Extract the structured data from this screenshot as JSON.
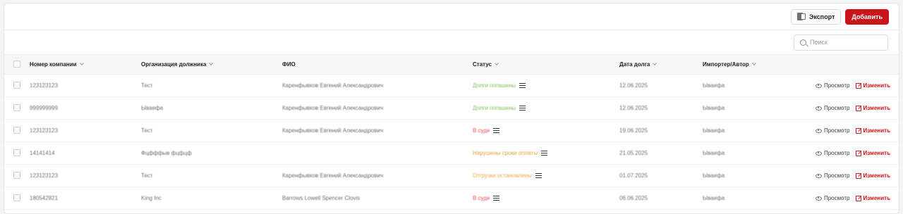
{
  "toolbar": {
    "export_label": "Экспорт",
    "add_label": "Добавить",
    "export_icon": "excel-icon"
  },
  "search": {
    "placeholder": "Поиск"
  },
  "columns": {
    "company_number": "Номер компании",
    "debtor_org": "Организация должника",
    "full_name": "ФИО",
    "status": "Статус",
    "debt_date": "Дата долга",
    "importer": "Импортер/Автор"
  },
  "rows": [
    {
      "company_number": "123123123",
      "debtor_org": "Тест",
      "full_name": "Каренфывков Евгений Александрович",
      "status": "Долги погашены",
      "status_color": "#79c25a",
      "debt_date": "12.06.2025",
      "importer": "Ываефа",
      "view": "Просмотр",
      "edit": "Изменить"
    },
    {
      "company_number": "999999999",
      "debtor_org": "Ываефа",
      "full_name": "Каренфывков Евгений Александрович",
      "status": "Долги погашены",
      "status_color": "#79c25a",
      "debt_date": "12.06.2025",
      "importer": "Ываефа",
      "view": "Просмотр",
      "edit": "Изменить"
    },
    {
      "company_number": "123123123",
      "debtor_org": "Тест",
      "full_name": "Каренфывков Евгений Александрович",
      "status": "В суде",
      "status_color": "#e5484d",
      "debt_date": "19.06.2025",
      "importer": "Ываефа",
      "view": "Просмотр",
      "edit": "Изменить"
    },
    {
      "company_number": "14141414",
      "debtor_org": "Фцфффыв фцфцф",
      "full_name": "",
      "status": "Нарушены сроки оплаты",
      "status_color": "#d9a13a",
      "debt_date": "21.05.2025",
      "importer": "Ываефа",
      "view": "Просмотр",
      "edit": "Изменить"
    },
    {
      "company_number": "123123123",
      "debtor_org": "Тест",
      "full_name": "Каренфывков Евгений Александрович",
      "status": "Отгрузки остановлены",
      "status_color": "#e8a84a",
      "debt_date": "01.07.2025",
      "importer": "Ываефа",
      "view": "Просмотр",
      "edit": "Изменить"
    },
    {
      "company_number": "180542821",
      "debtor_org": "King Inc",
      "full_name": "Barrows Lowell Spencer Clovis",
      "status": "В суде",
      "status_color": "#e5484d",
      "debt_date": "06.06.2025",
      "importer": "Ываефа",
      "view": "Просмотр",
      "edit": "Изменить"
    }
  ],
  "colors": {
    "accent": "#c8141a"
  }
}
